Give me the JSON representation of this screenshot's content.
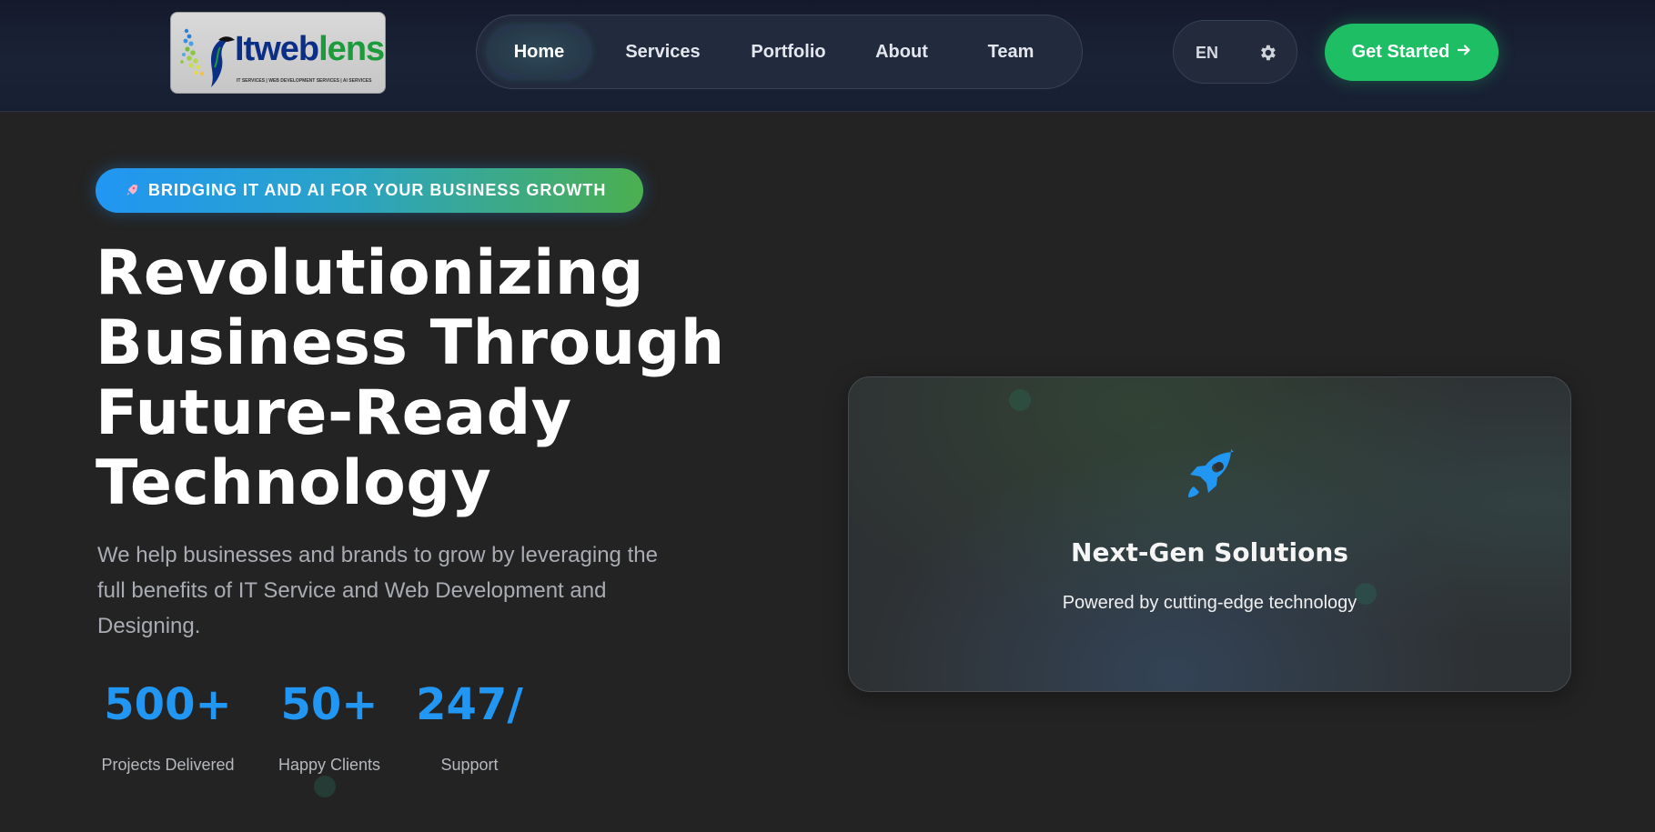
{
  "header": {
    "logo": {
      "word_part1": "It",
      "word_part2": "web",
      "word_part3": "lens",
      "tagline": "IT SERVICES | WEB DEVELOPMENT SERVICES | AI SERVICES",
      "colors": {
        "primary": "#0c2f86",
        "secondary": "#1c9a3c"
      }
    },
    "nav": [
      {
        "label": "Home",
        "active": true
      },
      {
        "label": "Services",
        "active": false
      },
      {
        "label": "Portfolio",
        "active": false
      },
      {
        "label": "About",
        "active": false
      },
      {
        "label": "Team",
        "active": false
      }
    ],
    "language": {
      "label": "EN",
      "icon": "gear-icon"
    },
    "cta": {
      "label": "Get Started",
      "icon": "arrow-right-icon",
      "color": "#1dbe64"
    }
  },
  "hero": {
    "badge": {
      "icon": "rocket-icon",
      "text": "BRIDGING IT AND AI FOR YOUR BUSINESS GROWTH"
    },
    "title_lines": [
      "Revolutionizing",
      "Business Through",
      "Future-Ready",
      "Technology"
    ],
    "subtitle": "We help businesses and brands to grow by leveraging the full benefits of IT Service and Web Development and Designing.",
    "stats": [
      {
        "value": "500+",
        "label": "Projects Delivered"
      },
      {
        "value": "50+",
        "label": "Happy Clients"
      },
      {
        "value": "247/",
        "label": "Support"
      }
    ],
    "accent_color": "#2196f3"
  },
  "card": {
    "icon": "rocket-icon",
    "title": "Next-Gen Solutions",
    "subtitle": "Powered by cutting-edge technology"
  }
}
